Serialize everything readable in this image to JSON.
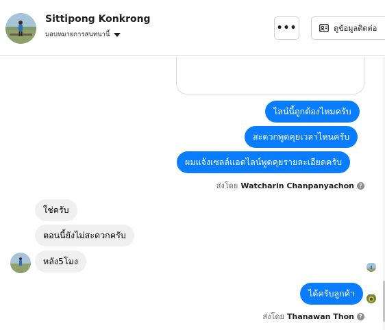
{
  "header": {
    "contact_name": "Sittipong Konkrong",
    "assign_label": "มอบหมายการสนทนานี้",
    "more_label": "•••",
    "contact_info_label": "ดูข้อมูลติดต่อ"
  },
  "messages": {
    "out_1": "ไลน์นี้ถูกต้องไหมครับ",
    "out_2": "สะดวกพูดคุยเวลาไหนครับ",
    "out_3": "ผมแจ้งเซลล์แอดไลน์พูดคุยรายละเอียดครับ",
    "sent_by_1_prefix": "ส่งโดย",
    "sent_by_1_agent": "Watcharin Chanpanyachon",
    "in_1": "ใช่ครับ",
    "in_2": "ตอนนี้ยังไม่สะดวกครับ",
    "in_3": "หลัง5โมง",
    "out_4": "ได้ครับลูกค้า",
    "sent_by_2_prefix": "ส่งโดย",
    "sent_by_2_agent": "Thanawan Thon",
    "info_glyph": "?"
  },
  "colors": {
    "outgoing_bubble": "#0a7cff",
    "incoming_bubble": "#f0f0f0",
    "secondary_text": "#65676b"
  },
  "icons": {
    "more": "more-horizontal-icon",
    "contact_card": "contact-card-icon",
    "caret": "caret-down-icon",
    "info": "info-icon"
  }
}
